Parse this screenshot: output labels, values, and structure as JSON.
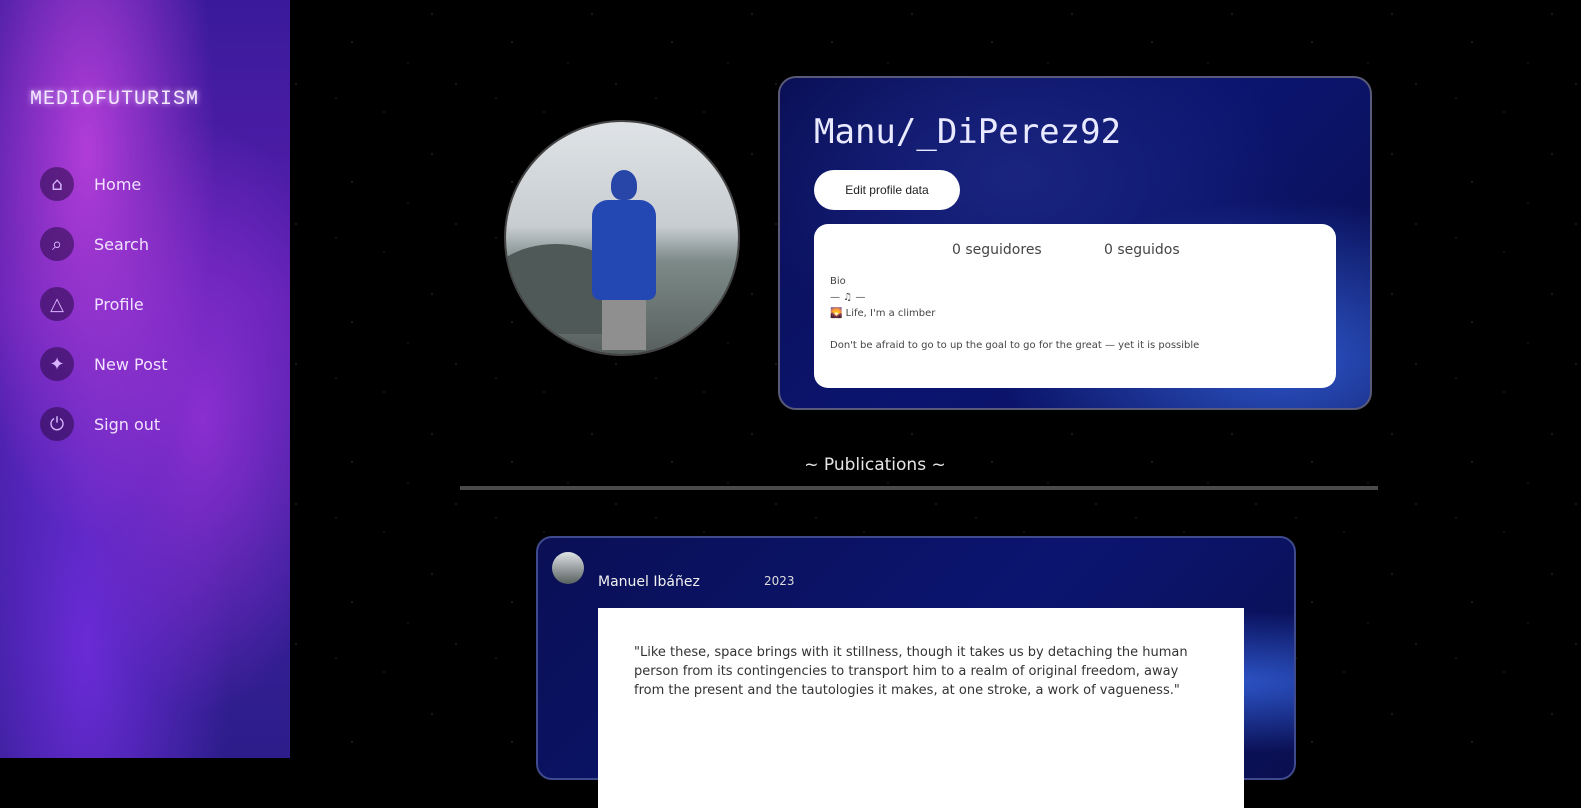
{
  "sidebar": {
    "logo": "MEDIOFUTURISM",
    "items": [
      {
        "label": "Home",
        "icon": "home-icon"
      },
      {
        "label": "Search",
        "icon": "search-icon"
      },
      {
        "label": "Profile",
        "icon": "profile-icon"
      },
      {
        "label": "New Post",
        "icon": "new-post-icon"
      },
      {
        "label": "Sign out",
        "icon": "sign-out-icon"
      }
    ]
  },
  "profile": {
    "username": "Manu/_DiPerez92",
    "edit_button": "Edit profile data",
    "following": "0 seguidores",
    "followers": "0 seguidos",
    "bio_lines": [
      "Bio",
      "— ♫ —",
      "🌄 Life, I'm a climber",
      "Don't be afraid to go to up the goal to go for the great — yet it is possible"
    ]
  },
  "publications": {
    "title": "~ Publications ~",
    "posts": [
      {
        "author": "Manuel Ibáñez",
        "date": "2023",
        "body": "\"Like these, space brings with it stillness, though it takes us by detaching the human person from its contingencies to transport him to a realm of original freedom, away from the present and the tautologies it makes, at one stroke, a work of vagueness.\""
      }
    ]
  }
}
